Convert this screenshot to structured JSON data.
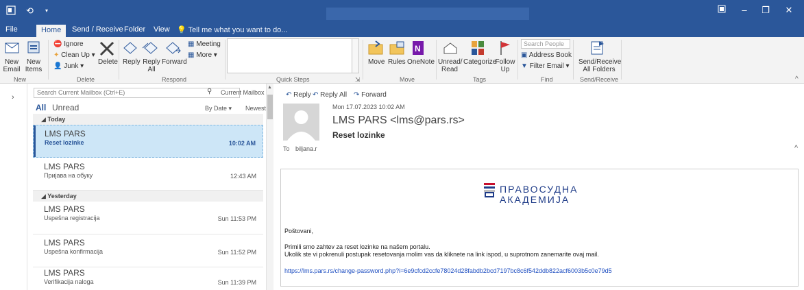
{
  "titlebar": {
    "icons": [
      "outlook-icon",
      "undo-icon",
      "customize-quick-access-icon"
    ],
    "window_buttons": [
      "restore-icon",
      "minimize-icon",
      "maximize-icon",
      "close-icon"
    ]
  },
  "tabs": [
    {
      "label": "File"
    },
    {
      "label": "Home"
    },
    {
      "label": "Send / Receive"
    },
    {
      "label": "Folder"
    },
    {
      "label": "View"
    },
    {
      "label": "Tell me what you want to do..."
    }
  ],
  "ribbon": {
    "new": {
      "new_email": "New\nEmail",
      "new_items": "New\nItems",
      "group": "New"
    },
    "delete": {
      "ignore": "Ignore",
      "cleanup": "Clean Up",
      "junk": "Junk",
      "delete": "Delete",
      "group": "Delete"
    },
    "respond": {
      "reply": "Reply",
      "reply_all": "Reply\nAll",
      "forward": "Forward",
      "meeting": "Meeting",
      "more": "More",
      "group": "Respond"
    },
    "quick_steps": {
      "group": "Quick Steps"
    },
    "move": {
      "move": "Move",
      "rules": "Rules",
      "onenote": "OneNote",
      "group": "Move"
    },
    "tags": {
      "unread_read": "Unread/\nRead",
      "categorize": "Categorize",
      "follow_up": "Follow\nUp",
      "group": "Tags"
    },
    "find": {
      "search_people_placeholder": "Search People",
      "address_book": "Address Book",
      "filter_email": "Filter Email",
      "group": "Find"
    },
    "send_receive": {
      "label": "Send/Receive\nAll Folders",
      "group": "Send/Receive"
    }
  },
  "mail_list": {
    "search_placeholder": "Search Current Mailbox (Ctrl+E)",
    "scope": "Current Mailbox",
    "filter_all": "All",
    "filter_unread": "Unread",
    "sort_by": "By Date",
    "sort_order": "Newest",
    "groups": [
      {
        "label": "Today"
      },
      {
        "label": "Yesterday"
      }
    ],
    "messages": [
      {
        "from": "LMS PARS",
        "subject": "Reset lozinke",
        "time": "10:02 AM"
      },
      {
        "from": "LMS PARS",
        "subject": "Пријава на обуку",
        "time": "12:43 AM"
      },
      {
        "from": "LMS PARS",
        "subject": "Uspešna registracija",
        "time": "Sun 11:53 PM"
      },
      {
        "from": "LMS PARS",
        "subject": "Uspešna konfirmacija",
        "time": "Sun 11:52 PM"
      },
      {
        "from": "LMS PARS",
        "subject": "Verifikacija naloga",
        "time": "Sun 11:39 PM"
      }
    ]
  },
  "reading_pane": {
    "actions": {
      "reply": "Reply",
      "reply_all": "Reply All",
      "forward": "Forward"
    },
    "date": "Mon 17.07.2023 10:02 AM",
    "from": "LMS PARS <lms@pars.rs>",
    "subject": "Reset lozinke",
    "to_label": "To",
    "to": "biljana.r",
    "logo": {
      "line1": "ПРАВОСУДНА",
      "line2": "АКАДЕМИЈА"
    },
    "body": {
      "greeting": "Poštovani,",
      "line1": "Primili smo zahtev za reset lozinke na našem portalu.",
      "line2": "Ukolik ste vi pokrenuli postupak resetovanja molim vas da kliknete na link ispod, u suprotnom zanemarite ovaj mail.",
      "link": "https://lms.pars.rs/change-password.php?i=6e9cfcd2ccfe78024d28fabdb2bcd7197bc8c6f542ddb822acf6003b5c0e79d5"
    }
  },
  "colors": {
    "accent": "#2b579a",
    "selected_bg": "#cde6f7",
    "link": "#1f4fc1"
  }
}
